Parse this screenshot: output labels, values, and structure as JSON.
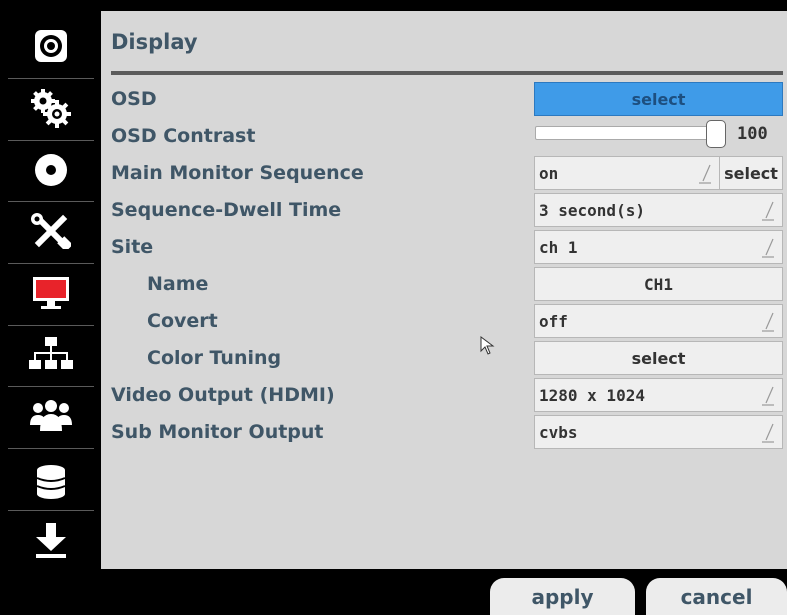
{
  "page": {
    "title": "Display"
  },
  "sidebar": {
    "items": [
      {
        "icon": "camera-icon"
      },
      {
        "icon": "gears-icon"
      },
      {
        "icon": "disc-icon"
      },
      {
        "icon": "tools-icon"
      },
      {
        "icon": "monitor-icon"
      },
      {
        "icon": "network-icon"
      },
      {
        "icon": "users-icon"
      },
      {
        "icon": "database-icon"
      },
      {
        "icon": "download-icon"
      }
    ]
  },
  "settings": {
    "osd": {
      "label": "OSD",
      "button": "select"
    },
    "osd_contrast": {
      "label": "OSD Contrast",
      "value": "100",
      "level_fraction": 1.0
    },
    "main_monitor_sequence": {
      "label": "Main Monitor Sequence",
      "value": "on",
      "button": "select"
    },
    "sequence_dwell_time": {
      "label": "Sequence-Dwell Time",
      "value": "3 second(s)"
    },
    "site": {
      "label": "Site",
      "value": "ch 1"
    },
    "name": {
      "label": "Name",
      "value": "CH1"
    },
    "covert": {
      "label": "Covert",
      "value": "off"
    },
    "color_tuning": {
      "label": "Color Tuning",
      "button": "select"
    },
    "video_output_hdmi": {
      "label": "Video Output (HDMI)",
      "value": "1280 x 1024"
    },
    "sub_monitor_output": {
      "label": "Sub Monitor Output",
      "value": "cvbs"
    }
  },
  "footer": {
    "apply": "apply",
    "cancel": "cancel"
  },
  "colors": {
    "accent": "#3f9be8",
    "label": "#3f5667",
    "panel": "#d7d7d7",
    "monitor_red": "#e8232a"
  }
}
